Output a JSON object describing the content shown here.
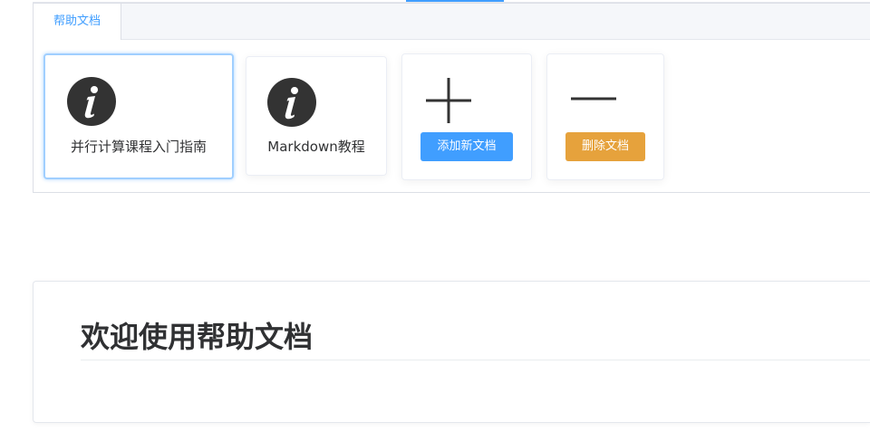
{
  "tabs": [
    {
      "label": "帮助文档",
      "active": true
    }
  ],
  "cards": [
    {
      "title": "并行计算课程入门指南",
      "icon": "info-icon",
      "selected": true
    },
    {
      "title": "Markdown教程",
      "icon": "info-icon",
      "selected": false
    }
  ],
  "actions": {
    "add": {
      "icon": "plus-icon",
      "button_label": "添加新文档"
    },
    "delete": {
      "icon": "minus-icon",
      "button_label": "删除文档"
    }
  },
  "main": {
    "heading": "欢迎使用帮助文档"
  },
  "colors": {
    "primary": "#409eff",
    "warning": "#e6a23c",
    "text": "#303133",
    "icon": "#333333"
  }
}
